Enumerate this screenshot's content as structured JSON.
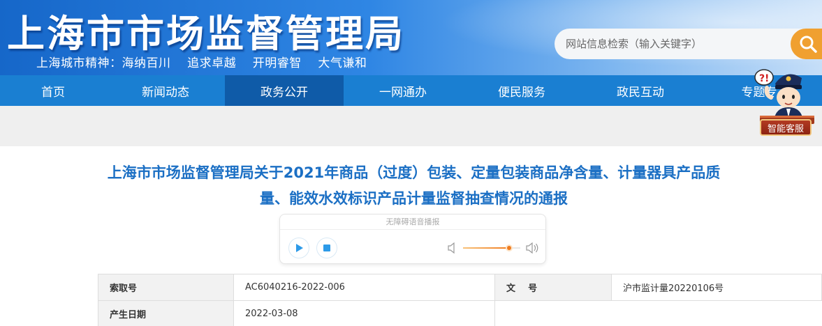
{
  "header": {
    "site_title": "上海市市场监督管理局",
    "city_spirit": "上海城市精神：海纳百川    追求卓越    开明睿智    大气谦和",
    "search": {
      "placeholder": "网站信息检索（输入关键字）",
      "icon": "search-icon"
    }
  },
  "nav": {
    "items": [
      {
        "label": "首页"
      },
      {
        "label": "新闻动态"
      },
      {
        "label": "政务公开",
        "active": true
      },
      {
        "label": "一网通办"
      },
      {
        "label": "便民服务"
      },
      {
        "label": "政民互动"
      },
      {
        "label": "专题专"
      }
    ]
  },
  "service": {
    "label": "智能客服",
    "icon": "police-mascot-icon"
  },
  "article": {
    "title": "上海市市场监督管理局关于2021年商品（过度）包装、定量包装商品净含量、计量器具产品质量、能效水效标识产品计量监督抽查情况的通报"
  },
  "audio": {
    "caption": "无障碍语音播报",
    "volume": 0.8
  },
  "info": {
    "rows": [
      {
        "label": "索取号",
        "value": "AC6040216-2022-006",
        "label2": "文    号",
        "value2": "沪市监计量20220106号"
      },
      {
        "label": "产生日期",
        "value": "2022-03-08"
      }
    ]
  },
  "colors": {
    "header_blue": "#2f86e4",
    "nav_blue": "#1a7fd2",
    "nav_active": "#0f5ba8",
    "title_blue": "#1b6fc4",
    "search_orange": "#f0a030",
    "accent_orange": "#f07b1d"
  }
}
